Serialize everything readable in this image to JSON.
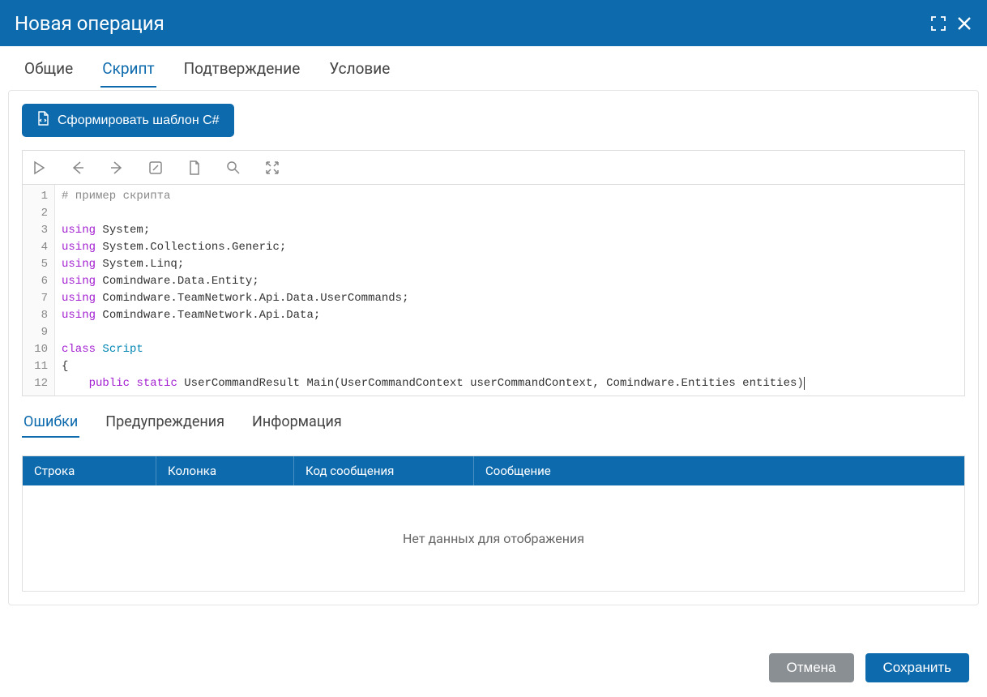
{
  "dialog": {
    "title": "Новая операция"
  },
  "tabs": {
    "items": [
      {
        "label": "Общие"
      },
      {
        "label": "Скрипт"
      },
      {
        "label": "Подтверждение"
      },
      {
        "label": "Условие"
      }
    ],
    "active_index": 1
  },
  "generate_button": {
    "label": "Сформировать шаблон C#"
  },
  "code": {
    "line_count": 12,
    "lines": [
      {
        "n": 1,
        "tokens": [
          {
            "t": "# пример скрипта",
            "c": "comment"
          }
        ]
      },
      {
        "n": 2,
        "tokens": []
      },
      {
        "n": 3,
        "tokens": [
          {
            "t": "using",
            "c": "using"
          },
          {
            "t": " System;",
            "c": "plain"
          }
        ]
      },
      {
        "n": 4,
        "tokens": [
          {
            "t": "using",
            "c": "using"
          },
          {
            "t": " System.Collections.Generic;",
            "c": "plain"
          }
        ]
      },
      {
        "n": 5,
        "tokens": [
          {
            "t": "using",
            "c": "using"
          },
          {
            "t": " System.Linq;",
            "c": "plain"
          }
        ]
      },
      {
        "n": 6,
        "tokens": [
          {
            "t": "using",
            "c": "using"
          },
          {
            "t": " Comindware.Data.Entity;",
            "c": "plain"
          }
        ]
      },
      {
        "n": 7,
        "tokens": [
          {
            "t": "using",
            "c": "using"
          },
          {
            "t": " Comindware.TeamNetwork.Api.Data.UserCommands;",
            "c": "plain"
          }
        ]
      },
      {
        "n": 8,
        "tokens": [
          {
            "t": "using",
            "c": "using"
          },
          {
            "t": " Comindware.TeamNetwork.Api.Data;",
            "c": "plain"
          }
        ]
      },
      {
        "n": 9,
        "tokens": []
      },
      {
        "n": 10,
        "tokens": [
          {
            "t": "class",
            "c": "keyword"
          },
          {
            "t": " ",
            "c": "plain"
          },
          {
            "t": "Script",
            "c": "type"
          }
        ]
      },
      {
        "n": 11,
        "tokens": [
          {
            "t": "{",
            "c": "plain"
          }
        ]
      },
      {
        "n": 12,
        "tokens": [
          {
            "t": "    ",
            "c": "plain"
          },
          {
            "t": "public",
            "c": "keyword"
          },
          {
            "t": " ",
            "c": "plain"
          },
          {
            "t": "static",
            "c": "keyword"
          },
          {
            "t": " UserCommandResult Main(UserCommandContext userCommandContext, Comindware.Entities entities)",
            "c": "plain"
          }
        ]
      }
    ]
  },
  "sub_tabs": {
    "items": [
      {
        "label": "Ошибки"
      },
      {
        "label": "Предупреждения"
      },
      {
        "label": "Информация"
      }
    ],
    "active_index": 0
  },
  "table": {
    "headers": {
      "line": "Строка",
      "column": "Колонка",
      "code": "Код сообщения",
      "message": "Сообщение"
    },
    "empty_text": "Нет данных для отображения"
  },
  "footer": {
    "cancel": "Отмена",
    "save": "Сохранить"
  }
}
